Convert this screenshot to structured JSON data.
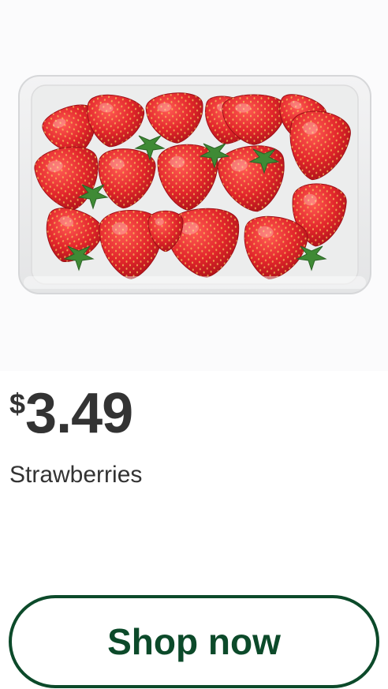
{
  "product": {
    "image_alt": "Strawberries in a clear plastic clamshell",
    "currency_symbol": "$",
    "price_amount": "3.49",
    "name": "Strawberries"
  },
  "actions": {
    "shop_now_label": "Shop now"
  },
  "colors": {
    "accent": "#0c4a2a",
    "text": "#333333",
    "berry": "#d9262b"
  }
}
